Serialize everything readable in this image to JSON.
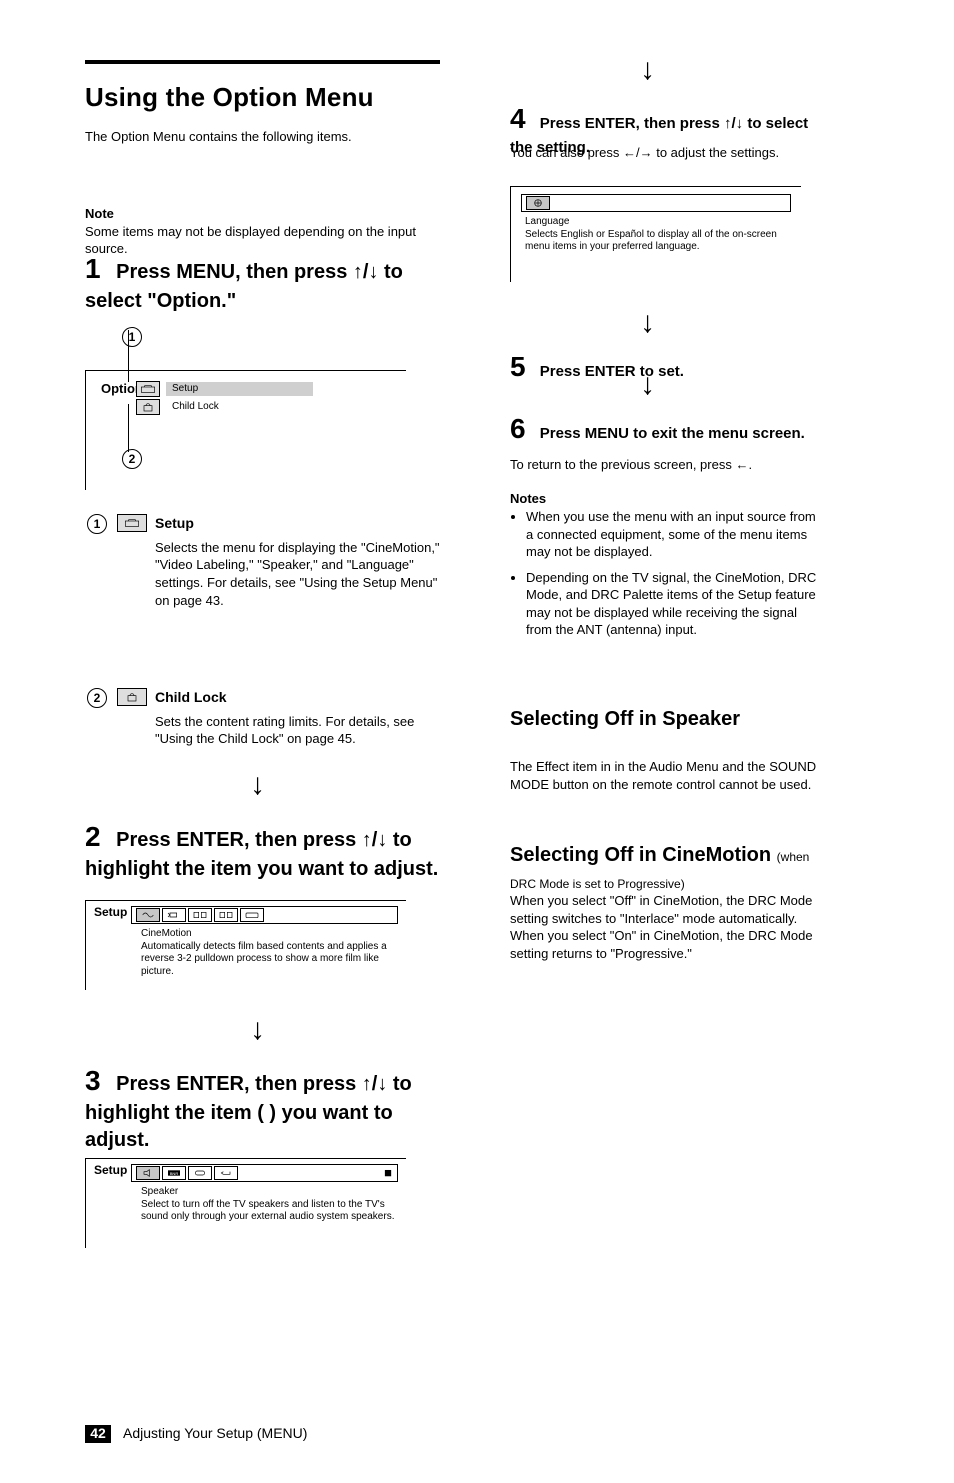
{
  "header": {
    "title": "Using the Option Menu",
    "subtitle": "The Option Menu contains the following items."
  },
  "note": {
    "label": "Note",
    "text": "Some items may not be displayed depending on the input source."
  },
  "step1": {
    "heading": "Press MENU, then press ↑/↓ to select \"Option.\"",
    "osd": {
      "brand": "Option",
      "rows": [
        {
          "icon": "toolbox-icon",
          "label": "Setup"
        },
        {
          "icon": "lock-icon",
          "label": "Child Lock"
        }
      ],
      "selected_index": 0
    }
  },
  "legend": {
    "items": [
      {
        "circled": "1",
        "icon": "toolbox-icon",
        "title": "Setup",
        "text": "Selects the menu for displaying the \"CineMotion,\" \"Video Labeling,\" \"Speaker,\" and \"Language\" settings. For details, see \"Using the Setup Menu\" on page 43."
      },
      {
        "circled": "2",
        "icon": "lock-icon",
        "title": "Child Lock",
        "text": "Sets the content rating limits. For details, see \"Using the Child Lock\" on page 45."
      }
    ]
  },
  "step2": {
    "heading": "Press ENTER, then press ↑/↓ to highlight the item you want to adjust.",
    "iconbar_caption": "CineMotion\nAutomatically detects film based contents and applies a reverse 3-2 pulldown process to show a more film like picture."
  },
  "step3": {
    "heading": "Press ENTER, then press ↑/↓ to highlight the item ( ) you want to adjust.",
    "iconbar_caption": "Speaker\nSelect to turn off the TV speakers and listen to the TV's sound only through your external audio system speakers.",
    "iconbar_right_mark": "■"
  },
  "right": {
    "step4": {
      "heading": "Press ENTER, then press ↑/↓ to select the setting.",
      "body": "You can also press ←/→ to adjust the settings."
    },
    "panel_caption": "Language\nSelects English or Español to display all of the on-screen menu items in your preferred language.",
    "step5": "Press ENTER to set.",
    "step6": {
      "heading": "Press MENU to exit the menu screen.",
      "body": "To return to the previous screen, press ←."
    },
    "notes": {
      "label": "Notes",
      "items": [
        "When you use the menu with an input source from a connected equipment, some of the menu items may not be displayed.",
        "Depending on the TV signal, the CineMotion, DRC Mode, and DRC Palette items of the Setup feature may not be displayed while receiving the signal from the ANT (antenna) input."
      ]
    },
    "h2": {
      "title": "Selecting Off in Speaker",
      "body": "The Effect item in in the Audio Menu and the SOUND MODE button on the remote control cannot be used."
    },
    "h3": {
      "title": "Selecting Off in CineMotion",
      "sub": "(when DRC Mode is set to Progressive)",
      "body": "When you select \"Off\" in CineMotion, the DRC Mode setting switches to \"Interlace\" mode automatically. When you select \"On\" in CineMotion, the DRC Mode setting returns to \"Progressive.\""
    }
  },
  "page": {
    "number": "42",
    "label": "Adjusting Your Setup (MENU)"
  }
}
